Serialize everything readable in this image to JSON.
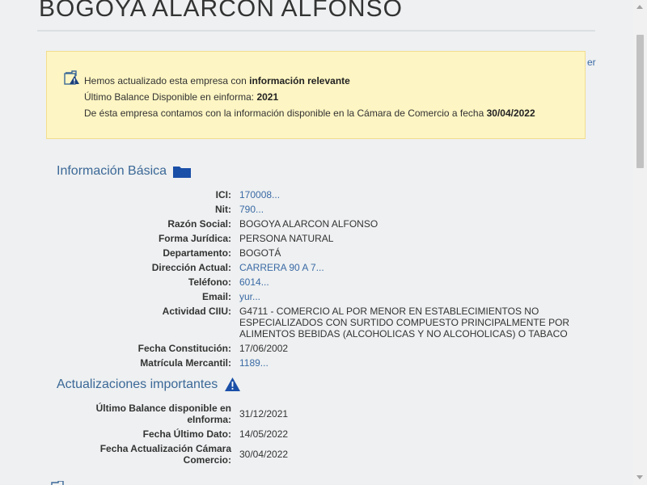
{
  "company": {
    "title": "BOGOYA ALARCON ALFONSO"
  },
  "side_link": "er",
  "notice": {
    "line1_prefix": "Hemos actualizado esta empresa con ",
    "line1_bold": "información relevante",
    "line2_prefix": "Último Balance Disponible en einforma: ",
    "line2_bold": "2021",
    "line3_prefix": "De ésta empresa contamos con la información disponible en la Cámara de Comercio a fecha ",
    "line3_bold": "30/04/2022"
  },
  "basic_info": {
    "heading": "Información Básica",
    "icon": "folder-icon",
    "fields": [
      {
        "label": "ICI:",
        "value": "170008..."
      },
      {
        "label": "Nit:",
        "value": "790..."
      },
      {
        "label": "Razón Social:",
        "value": "BOGOYA ALARCON ALFONSO"
      },
      {
        "label": "Forma Jurídica:",
        "value": "PERSONA NATURAL"
      },
      {
        "label": "Departamento:",
        "value": "BOGOTÁ"
      },
      {
        "label": "Dirección Actual:",
        "value": "CARRERA 90 A 7..."
      },
      {
        "label": "Teléfono:",
        "value": "6014..."
      },
      {
        "label": "Email:",
        "value": "yur..."
      },
      {
        "label": "Actividad CIIU:",
        "value_lines": [
          "G4711 - COMERCIO AL POR MENOR EN ESTABLECIMIENTOS NO",
          "ESPECIALIZADOS CON SURTIDO COMPUESTO PRINCIPALMENTE POR",
          "ALIMENTOS BEBIDAS (ALCOHOLICAS Y NO ALCOHOLICAS) O TABACO"
        ]
      },
      {
        "label": "Fecha Constitución:",
        "value": "17/06/2002"
      },
      {
        "label": "Matrícula Mercantil:",
        "value": "1189..."
      }
    ]
  },
  "updates": {
    "heading": "Actualizaciones importantes",
    "icon": "warning-icon",
    "fields": [
      {
        "label_lines": [
          "Último Balance disponible en",
          "eInforma:"
        ],
        "value": "31/12/2021"
      },
      {
        "label": "Fecha Último Dato:",
        "value": "14/05/2022"
      },
      {
        "label_lines": [
          "Fecha Actualización Cámara",
          "Comercio:"
        ],
        "value": "30/04/2022"
      }
    ]
  },
  "colors": {
    "link": "#3a6aa5",
    "heading": "#3b6897",
    "notice_bg": "#fdf5c3",
    "icon_blue": "#1a4fa8"
  }
}
